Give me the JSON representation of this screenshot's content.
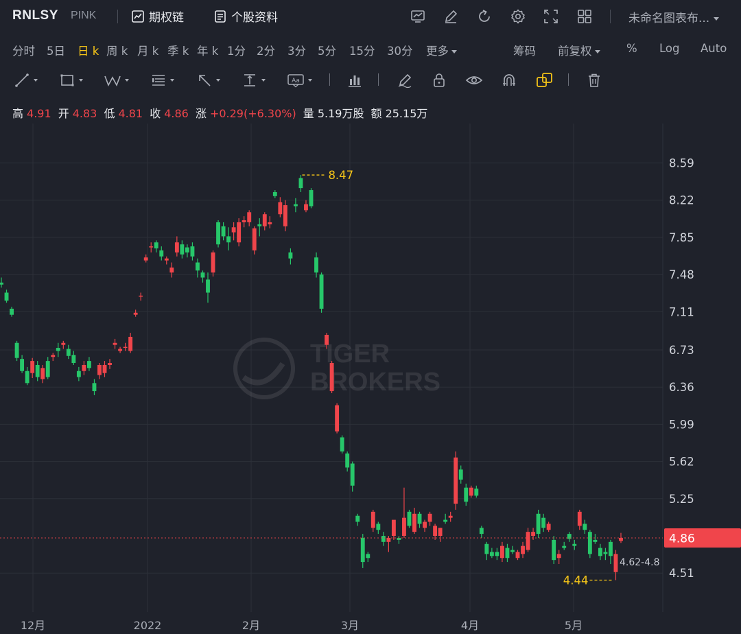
{
  "header": {
    "symbol": "RNLSY",
    "exchange": "PINK",
    "option_chain": "期权链",
    "stock_profile": "个股资料",
    "layout_name": "未命名图表布...",
    "icons": [
      "chart-settings-icon",
      "draw-edit-icon",
      "refresh-icon",
      "gear-icon",
      "fullscreen-icon",
      "layout-grid-icon"
    ]
  },
  "periods": {
    "items": [
      "分时",
      "5日",
      "日 k",
      "周 k",
      "月 k",
      "季 k",
      "年 k",
      "1分",
      "2分",
      "3分",
      "5分",
      "15分",
      "30分",
      "更多"
    ],
    "active": "日 k",
    "chips": "筹码",
    "adjust": "前复权",
    "percent": "%",
    "log": "Log",
    "auto": "Auto"
  },
  "info": {
    "high_label": "高",
    "high": "4.91",
    "open_label": "开",
    "open": "4.83",
    "low_label": "低",
    "low": "4.81",
    "close_label": "收",
    "close": "4.86",
    "change_label": "涨",
    "change": "+0.29(+6.30%)",
    "volume_label": "量",
    "volume": "5.19万股",
    "amount_label": "额",
    "amount": "25.15万"
  },
  "colors": {
    "up": "#f0454b",
    "down": "#27c76a",
    "marker": "#f5c518",
    "background": "#1f222b",
    "active": "#f5c518"
  },
  "chart_data": {
    "type": "candlestick",
    "y_ticks": [
      "8.59",
      "8.22",
      "7.85",
      "7.48",
      "7.11",
      "6.73",
      "6.36",
      "5.99",
      "5.62",
      "5.25",
      "4.51"
    ],
    "ylim": [
      4.4,
      8.7
    ],
    "x_ticks": [
      "12月",
      "2022",
      "2月",
      "3月",
      "4月",
      "5月"
    ],
    "last_price": "4.86",
    "max_label": "8.47",
    "min_label": "4.44",
    "range_label": "4.62-4.8",
    "watermark": [
      "TIGER",
      "BROKERS"
    ],
    "candles": [
      [
        7.4,
        7.45,
        7.35,
        7.38
      ],
      [
        7.3,
        7.33,
        7.2,
        7.22
      ],
      [
        7.14,
        7.16,
        7.06,
        7.08
      ],
      [
        6.8,
        6.82,
        6.62,
        6.65
      ],
      [
        6.64,
        6.68,
        6.5,
        6.52
      ],
      [
        6.52,
        6.56,
        6.38,
        6.4
      ],
      [
        6.5,
        6.65,
        6.45,
        6.62
      ],
      [
        6.58,
        6.62,
        6.42,
        6.46
      ],
      [
        6.44,
        6.58,
        6.4,
        6.55
      ],
      [
        6.62,
        6.66,
        6.44,
        6.46
      ],
      [
        6.66,
        6.7,
        6.62,
        6.68
      ],
      [
        6.75,
        6.8,
        6.66,
        6.72
      ],
      [
        6.78,
        6.82,
        6.74,
        6.8
      ],
      [
        6.74,
        6.78,
        6.64,
        6.67
      ],
      [
        6.68,
        6.72,
        6.58,
        6.6
      ],
      [
        6.52,
        6.56,
        6.42,
        6.46
      ],
      [
        6.52,
        6.62,
        6.48,
        6.58
      ],
      [
        6.62,
        6.66,
        6.52,
        6.55
      ],
      [
        6.4,
        6.44,
        6.28,
        6.32
      ],
      [
        6.48,
        6.6,
        6.44,
        6.58
      ],
      [
        6.5,
        6.62,
        6.46,
        6.58
      ],
      [
        6.58,
        6.64,
        6.54,
        6.6
      ],
      [
        6.78,
        6.84,
        6.74,
        6.8
      ],
      [
        6.72,
        6.76,
        6.7,
        6.74
      ],
      [
        6.76,
        6.8,
        6.72,
        6.76
      ],
      [
        6.72,
        6.9,
        6.7,
        6.86
      ],
      [
        7.08,
        7.13,
        7.06,
        7.1
      ],
      [
        7.26,
        7.3,
        7.22,
        7.27
      ],
      [
        7.62,
        7.68,
        7.6,
        7.65
      ],
      [
        7.75,
        7.8,
        7.7,
        7.76
      ],
      [
        7.8,
        7.82,
        7.7,
        7.74
      ],
      [
        7.72,
        7.76,
        7.62,
        7.66
      ],
      [
        7.62,
        7.66,
        7.58,
        7.64
      ],
      [
        7.5,
        7.6,
        7.45,
        7.55
      ],
      [
        7.7,
        7.86,
        7.66,
        7.8
      ],
      [
        7.78,
        7.82,
        7.64,
        7.68
      ],
      [
        7.75,
        7.78,
        7.65,
        7.7
      ],
      [
        7.76,
        7.8,
        7.62,
        7.66
      ],
      [
        7.6,
        7.64,
        7.45,
        7.52
      ],
      [
        7.5,
        7.52,
        7.4,
        7.45
      ],
      [
        7.43,
        7.5,
        7.2,
        7.3
      ],
      [
        7.5,
        7.72,
        7.46,
        7.7
      ],
      [
        8.0,
        8.02,
        7.75,
        7.78
      ],
      [
        7.96,
        8.0,
        7.82,
        7.86
      ],
      [
        7.86,
        7.95,
        7.72,
        7.8
      ],
      [
        7.9,
        8.0,
        7.82,
        7.95
      ],
      [
        7.8,
        8.04,
        7.76,
        8.0
      ],
      [
        8.0,
        8.06,
        7.95,
        8.02
      ],
      [
        8.0,
        8.12,
        7.96,
        8.1
      ],
      [
        7.72,
        7.96,
        7.68,
        7.94
      ],
      [
        7.98,
        8.04,
        7.86,
        7.96
      ],
      [
        7.96,
        8.1,
        7.92,
        8.08
      ],
      [
        7.98,
        8.06,
        7.94,
        8.0
      ],
      [
        8.3,
        8.32,
        8.24,
        8.26
      ],
      [
        8.08,
        8.25,
        8.05,
        8.2
      ],
      [
        7.96,
        8.22,
        7.91,
        8.17
      ],
      [
        7.7,
        7.74,
        7.58,
        7.64
      ],
      [
        8.18,
        8.24,
        8.1,
        8.16
      ],
      [
        8.44,
        8.47,
        8.3,
        8.34
      ],
      [
        8.12,
        8.22,
        8.1,
        8.18
      ],
      [
        8.32,
        8.34,
        8.14,
        8.16
      ],
      [
        7.65,
        7.7,
        7.45,
        7.5
      ],
      [
        7.48,
        7.5,
        7.1,
        7.14
      ],
      [
        6.78,
        6.9,
        6.74,
        6.88
      ],
      [
        6.32,
        6.62,
        6.3,
        6.6
      ],
      [
        5.92,
        6.2,
        5.9,
        6.18
      ],
      [
        5.86,
        5.88,
        5.7,
        5.72
      ],
      [
        5.7,
        5.72,
        5.52,
        5.56
      ],
      [
        5.6,
        5.62,
        5.32,
        5.38
      ],
      [
        5.08,
        5.1,
        4.98,
        5.02
      ],
      [
        4.86,
        4.9,
        4.56,
        4.62
      ],
      [
        4.7,
        4.72,
        4.62,
        4.66
      ],
      [
        4.96,
        5.14,
        4.92,
        5.12
      ],
      [
        5.0,
        5.02,
        4.9,
        4.94
      ],
      [
        4.88,
        4.92,
        4.78,
        4.82
      ],
      [
        4.82,
        4.88,
        4.72,
        4.86
      ],
      [
        4.88,
        5.0,
        4.84,
        5.04
      ],
      [
        4.86,
        4.88,
        4.8,
        4.84
      ],
      [
        4.88,
        5.36,
        4.86,
        5.06
      ],
      [
        5.12,
        5.14,
        4.96,
        4.98
      ],
      [
        4.92,
        5.16,
        4.9,
        5.1
      ],
      [
        5.1,
        5.12,
        4.96,
        5.0
      ],
      [
        4.96,
        5.04,
        4.92,
        5.02
      ],
      [
        5.02,
        5.12,
        4.98,
        5.1
      ],
      [
        4.88,
        5.0,
        4.84,
        4.98
      ],
      [
        4.88,
        4.96,
        4.82,
        4.96
      ],
      [
        5.04,
        5.1,
        5.0,
        5.02
      ],
      [
        5.06,
        5.12,
        5.02,
        5.08
      ],
      [
        5.2,
        5.72,
        5.14,
        5.66
      ],
      [
        5.54,
        5.58,
        5.4,
        5.44
      ],
      [
        5.36,
        5.4,
        5.18,
        5.22
      ],
      [
        5.28,
        5.38,
        5.26,
        5.36
      ],
      [
        5.35,
        5.38,
        5.26,
        5.28
      ],
      [
        4.96,
        4.98,
        4.86,
        4.9
      ],
      [
        4.8,
        4.82,
        4.64,
        4.7
      ],
      [
        4.72,
        4.76,
        4.66,
        4.68
      ],
      [
        4.72,
        4.76,
        4.64,
        4.68
      ],
      [
        4.66,
        4.82,
        4.62,
        4.78
      ],
      [
        4.76,
        4.8,
        4.62,
        4.66
      ],
      [
        4.74,
        4.78,
        4.7,
        4.72
      ],
      [
        4.66,
        4.74,
        4.64,
        4.72
      ],
      [
        4.7,
        4.82,
        4.66,
        4.78
      ],
      [
        4.74,
        4.96,
        4.72,
        4.92
      ],
      [
        4.88,
        4.96,
        4.84,
        4.92
      ],
      [
        5.1,
        5.14,
        4.86,
        4.9
      ],
      [
        5.06,
        5.1,
        4.92,
        4.96
      ],
      [
        4.94,
        5.02,
        4.92,
        5.0
      ],
      [
        4.84,
        4.88,
        4.6,
        4.64
      ],
      [
        4.66,
        4.74,
        4.6,
        4.7
      ],
      [
        4.78,
        4.82,
        4.74,
        4.76
      ],
      [
        4.9,
        4.92,
        4.82,
        4.85
      ],
      [
        4.8,
        4.84,
        4.74,
        4.78
      ],
      [
        4.98,
        5.14,
        4.94,
        5.12
      ],
      [
        5.0,
        5.04,
        4.9,
        4.94
      ],
      [
        4.92,
        4.94,
        4.66,
        4.7
      ],
      [
        4.84,
        4.9,
        4.8,
        4.82
      ],
      [
        4.76,
        4.8,
        4.64,
        4.68
      ],
      [
        4.72,
        4.76,
        4.64,
        4.7
      ],
      [
        4.82,
        4.84,
        4.6,
        4.68
      ],
      [
        4.52,
        4.74,
        4.44,
        4.7
      ],
      [
        4.83,
        4.91,
        4.81,
        4.86
      ]
    ]
  }
}
